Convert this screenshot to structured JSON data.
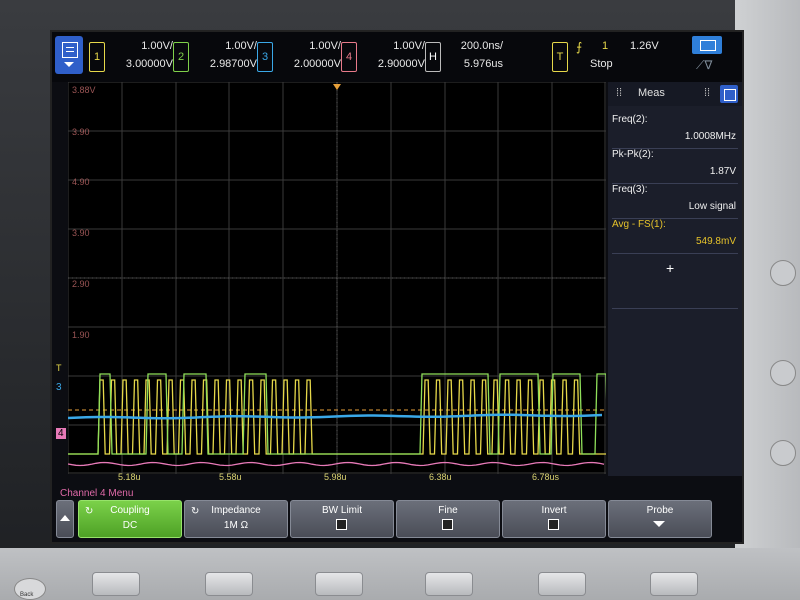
{
  "top_bar": {
    "channels": [
      {
        "id": "1",
        "scale": "1.00V/",
        "offset": "3.00000V",
        "color": "#e6d84a"
      },
      {
        "id": "2",
        "scale": "1.00V/",
        "offset": "2.98700V",
        "color": "#7fd14a"
      },
      {
        "id": "3",
        "scale": "1.00V/",
        "offset": "2.00000V",
        "color": "#3aa8e8"
      },
      {
        "id": "4",
        "scale": "1.00V/",
        "offset": "2.90000V",
        "color": "#e87a8a"
      }
    ],
    "horizontal": {
      "badge": "H",
      "scale": "200.0ns/",
      "position": "5.976us"
    },
    "trigger": {
      "badge": "T",
      "source": "1",
      "level": "1.26V",
      "state": "Stop",
      "edge_icon": "rising-edge-icon"
    }
  },
  "grid": {
    "y_labels": [
      "3.88V",
      "3.90",
      "4.90",
      "3.90",
      "2.90",
      "1.90"
    ],
    "x_labels": [
      "5.18u",
      "5.58u",
      "5.98u",
      "6.38u",
      "6.78us"
    ],
    "channel_markers": [
      "T",
      "3",
      "4"
    ]
  },
  "measurements": {
    "title": "Meas",
    "items": [
      {
        "label": "Freq(2):",
        "value": "1.0008MHz",
        "selected": false
      },
      {
        "label": "Pk-Pk(2):",
        "value": "1.87V",
        "selected": false
      },
      {
        "label": "Freq(3):",
        "value": "Low signal",
        "selected": false
      },
      {
        "label": "Avg - FS(1):",
        "value": "549.8mV",
        "selected": true
      }
    ],
    "add_symbol": "+"
  },
  "menu": {
    "title": "Channel 4 Menu",
    "softkeys": [
      {
        "label": "Coupling",
        "value": "DC"
      },
      {
        "label": "Impedance",
        "value": "1M Ω"
      },
      {
        "label": "BW Limit",
        "value": ""
      },
      {
        "label": "Fine",
        "value": ""
      },
      {
        "label": "Invert",
        "value": ""
      },
      {
        "label": "Probe",
        "value": ""
      }
    ]
  },
  "hardware": {
    "back_label": "Back"
  },
  "colors": {
    "ch1": "#e6d84a",
    "ch2": "#7fd14a",
    "ch3": "#3aa8e8",
    "ch4": "#e87ab8",
    "grid": "#3a3a3a",
    "accent": "#2f5fc9"
  }
}
